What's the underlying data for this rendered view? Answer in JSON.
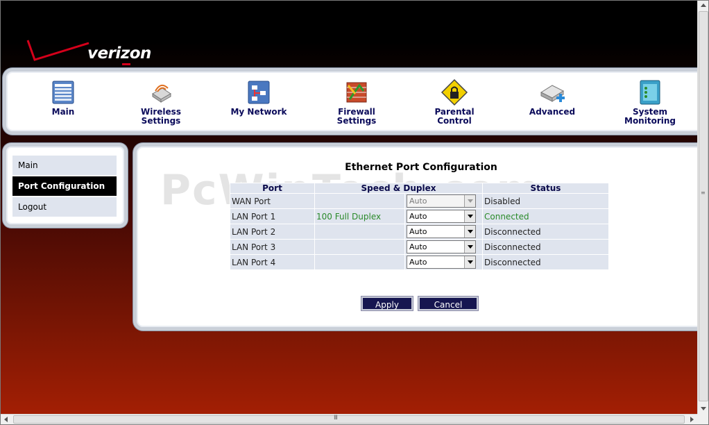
{
  "brand": {
    "logo_text_a": "veri",
    "logo_text_z": "z",
    "logo_text_b": "on",
    "accent": "#d4001a"
  },
  "nav": {
    "items": [
      {
        "line1": "Main",
        "line2": "",
        "icon": "main-icon"
      },
      {
        "line1": "Wireless",
        "line2": "Settings",
        "icon": "wireless-icon"
      },
      {
        "line1": "My Network",
        "line2": "",
        "icon": "network-icon"
      },
      {
        "line1": "Firewall",
        "line2": "Settings",
        "icon": "firewall-icon"
      },
      {
        "line1": "Parental",
        "line2": "Control",
        "icon": "parental-lock-icon"
      },
      {
        "line1": "Advanced",
        "line2": "",
        "icon": "advanced-icon"
      },
      {
        "line1": "System",
        "line2": "Monitoring",
        "icon": "monitor-icon"
      }
    ]
  },
  "sidebar": {
    "items": [
      {
        "label": "Main",
        "active": false
      },
      {
        "label": "Port Configuration",
        "active": true
      },
      {
        "label": "Logout",
        "active": false
      }
    ]
  },
  "main": {
    "watermark": "PcWinTech.com",
    "title": "Ethernet Port Configuration",
    "columns": {
      "port": "Port",
      "speed": "Speed & Duplex",
      "status": "Status"
    },
    "rows": [
      {
        "port": "WAN Port",
        "speed": "",
        "duplex_value": "Auto",
        "disabled": true,
        "status": "Disabled",
        "status_color": "#222222"
      },
      {
        "port": "LAN Port 1",
        "speed": "100 Full Duplex",
        "duplex_value": "Auto",
        "disabled": false,
        "status": "Connected",
        "status_color": "#2a8a2a"
      },
      {
        "port": "LAN Port 2",
        "speed": "",
        "duplex_value": "Auto",
        "disabled": false,
        "status": "Disconnected",
        "status_color": "#222222"
      },
      {
        "port": "LAN Port 3",
        "speed": "",
        "duplex_value": "Auto",
        "disabled": false,
        "status": "Disconnected",
        "status_color": "#222222"
      },
      {
        "port": "LAN Port 4",
        "speed": "",
        "duplex_value": "Auto",
        "disabled": false,
        "status": "Disconnected",
        "status_color": "#222222"
      }
    ],
    "apply_label": "Apply",
    "cancel_label": "Cancel"
  },
  "scrollbar": {
    "h_grip": "III",
    "v_grip": "≡"
  }
}
